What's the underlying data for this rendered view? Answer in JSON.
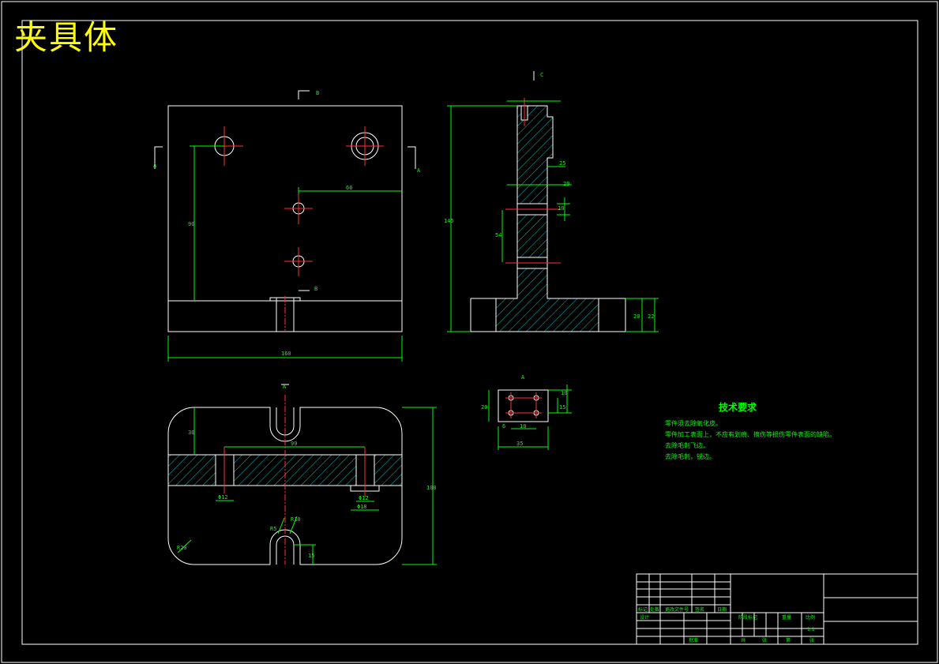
{
  "title": "夹具体",
  "tech_requirements": {
    "heading": "技术要求",
    "items": [
      "零件须去除氧化皮。",
      "零件加工表面上，不应有划痕、擦伤等损伤零件表面的缺陷。",
      "去除毛刺飞边。",
      "去除毛刺，锐边。"
    ]
  },
  "dimensions": {
    "front_width": "160",
    "front_height": "90",
    "hole_offset": "66",
    "side_height": "145",
    "side_t1": "25",
    "side_t2": "20",
    "side_t3": "10",
    "side_slot": "54",
    "side_base1": "20",
    "side_base2": "22",
    "top_h": "30",
    "top_len": "99",
    "top_depth": "100",
    "bore1": "Φ12",
    "bore2": "Φ12",
    "bore3": "Φ18",
    "radius": "R10",
    "radius_small": "R5",
    "corner": "R20",
    "slot_w": "15",
    "detail_w": "35",
    "detail_h": "20",
    "detail_a": "10",
    "detail_b": "15",
    "detail_c": "10",
    "detail_d": "6"
  },
  "section_labels": {
    "a": "A",
    "b": "B",
    "c": "C"
  },
  "title_block": {
    "r1": "标记",
    "r2": "处数",
    "r3": "更改文件号",
    "r4": "签名",
    "r5": "日期",
    "design": "设计",
    "stage": "阶段标记",
    "weight": "重量",
    "scale": "比例",
    "scale_val": "1:1",
    "sheet": "共",
    "sheet2": "张",
    "sheet3": "第",
    "sheet4": "张",
    "approve": "批准"
  }
}
